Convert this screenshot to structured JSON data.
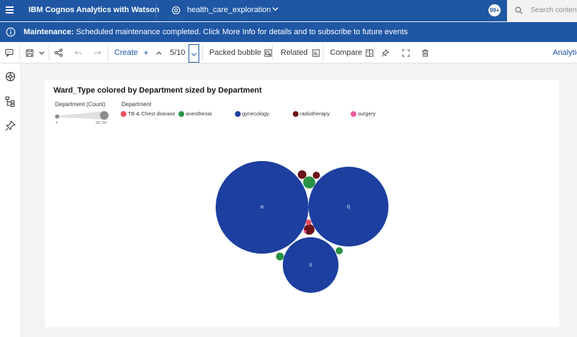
{
  "topbar": {
    "brand": "IBM Cognos Analytics with Watson",
    "workspace": "health_care_exploration",
    "notification_count": "99+",
    "search_placeholder": "Search content"
  },
  "banner": {
    "title": "Maintenance:",
    "message": "Scheduled maintenance completed. Click More Info for details and to subscribe to future events"
  },
  "toolbar": {
    "create_label": "Create",
    "page_indicator": "5/10",
    "viz_type_label": "Packed bubble",
    "related_label": "Related",
    "compare_label": "Compare",
    "analytics_label": "Analytics"
  },
  "colors": {
    "TB & Chest disease": "#f05062",
    "anesthesia": "#2a9244",
    "gynecology": "#1c3fa0",
    "radiotherapy": "#6a1318",
    "surgery": "#ee5b9a"
  },
  "chart_data": {
    "type": "packed bubble",
    "title": "Ward_Type colored by Department sized by Department",
    "size_legend_title": "Department (Count)",
    "size_range": [
      "4",
      "99,730"
    ],
    "color_legend_title": "Department",
    "legend": [
      "TB & Chest disease",
      "anesthesia",
      "gynecology",
      "radiotherapy",
      "surgery"
    ],
    "labels": [
      "R",
      "Q",
      "S"
    ],
    "bubbles": [
      {
        "ward": "R",
        "department": "gynecology",
        "label": "R"
      },
      {
        "ward": "Q",
        "department": "gynecology",
        "label": "Q"
      },
      {
        "ward": "S",
        "department": "gynecology",
        "label": "S"
      },
      {
        "ward": "",
        "department": "anesthesia",
        "label": ""
      },
      {
        "ward": "",
        "department": "radiotherapy",
        "label": ""
      },
      {
        "ward": "",
        "department": "radiotherapy",
        "label": ""
      },
      {
        "ward": "",
        "department": "radiotherapy",
        "label": ""
      },
      {
        "ward": "",
        "department": "TB & Chest disease",
        "label": ""
      },
      {
        "ward": "",
        "department": "anesthesia",
        "label": ""
      },
      {
        "ward": "",
        "department": "anesthesia",
        "label": ""
      },
      {
        "ward": "",
        "department": "surgery",
        "label": ""
      }
    ]
  }
}
